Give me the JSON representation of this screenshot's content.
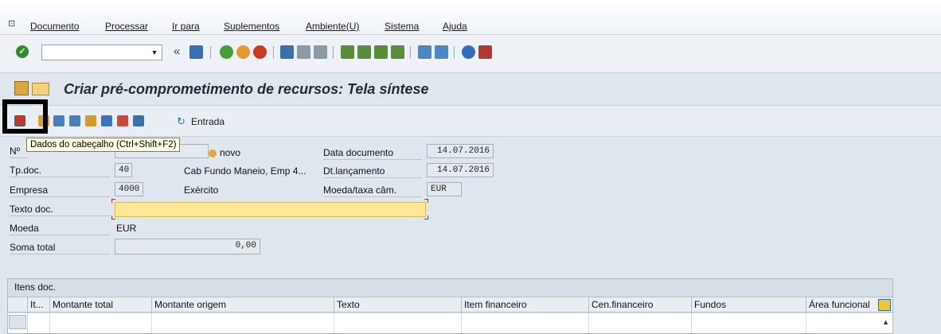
{
  "menu": {
    "items": [
      "Documento",
      "Processar",
      "Ir para",
      "Suplementos",
      "Ambiente(U)",
      "Sistema",
      "Ajuda"
    ]
  },
  "toolbar": {
    "command_value": "",
    "nav_label": "«"
  },
  "title": "Criar pré-comprometimento de recursos: Tela síntese",
  "app_toolbar": {
    "entrada_label": "Entrada",
    "tooltip": "Dados do cabeçalho   (Ctrl+Shift+F2)"
  },
  "form": {
    "numero_label": "Nº",
    "novo_label": "novo",
    "data_documento_label": "Data documento",
    "data_documento_value": "14.07.2016",
    "tpdoc_label": "Tp.doc.",
    "tpdoc_value": "40",
    "tpdoc_desc": "Cab Fundo Maneio, Emp 4...",
    "dt_lancamento_label": "Dt.lançamento",
    "dt_lancamento_value": "14.07.2016",
    "empresa_label": "Empresa",
    "empresa_value": "4000",
    "exercicio_label": "Exército",
    "moeda_taxa_label": "Moeda/taxa câm.",
    "moeda_taxa_value": "EUR",
    "texto_doc_label": "Texto doc.",
    "texto_doc_value": "",
    "moeda_label": "Moeda",
    "moeda_value": "EUR",
    "soma_total_label": "Soma total",
    "soma_total_value": "0,00"
  },
  "table": {
    "title": "Itens doc.",
    "columns": [
      "It...",
      "Montante total",
      "Montante origem",
      "Texto",
      "Item financeiro",
      "Cen.financeiro",
      "Fundos",
      "Área funcional"
    ]
  }
}
